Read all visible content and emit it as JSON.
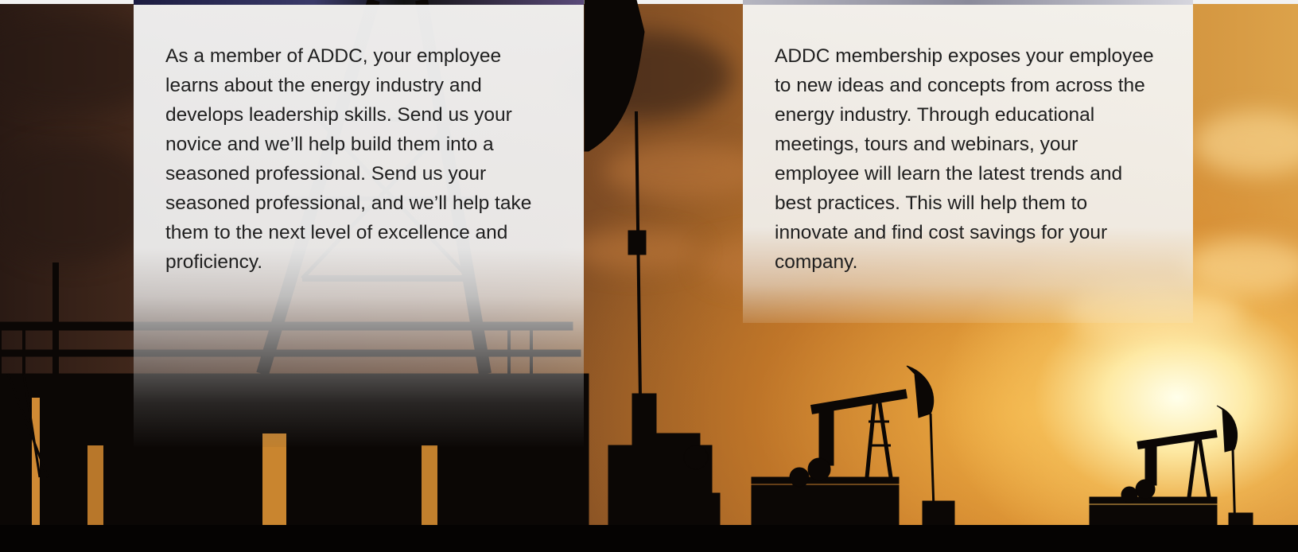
{
  "background": {
    "description_icon": "oil-pumpjack-sunset-image",
    "sky_colors": [
      "#2a1a14",
      "#8a5426",
      "#dca24a",
      "#fff6d8"
    ]
  },
  "cards": [
    {
      "id": "leadership",
      "text": "As a member of ADDC, your employee learns about the energy industry and develops leadership skills. Send us your novice and we’ll help build them into a seasoned professional. Send us your seasoned professional, and we’ll help take them to the next level of excellence and proficiency."
    },
    {
      "id": "industry-exposure",
      "text": "ADDC membership exposes your employee to new ideas and concepts from across the energy industry. Through educational meetings, tours and webinars, your employee will learn the latest trends and best practices. This will help them to innovate and find cost savings for your company."
    }
  ]
}
